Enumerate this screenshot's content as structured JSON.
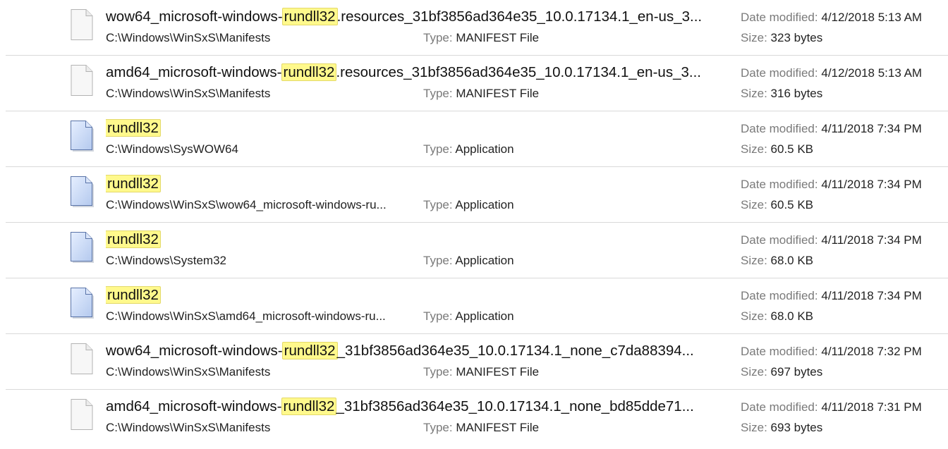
{
  "labels": {
    "type": "Type:",
    "date_modified": "Date modified:",
    "size": "Size:"
  },
  "items": [
    {
      "name_pre": "wow64_microsoft-windows-",
      "name_hl": "rundll32",
      "name_post": ".resources_31bf3856ad364e35_10.0.17134.1_en-us_3...",
      "path": "C:\\Windows\\WinSxS\\Manifests",
      "type": "MANIFEST File",
      "date_modified": "4/12/2018 5:13 AM",
      "size": "323 bytes",
      "icon": "manifest-file-icon"
    },
    {
      "name_pre": "amd64_microsoft-windows-",
      "name_hl": "rundll32",
      "name_post": ".resources_31bf3856ad364e35_10.0.17134.1_en-us_3...",
      "path": "C:\\Windows\\WinSxS\\Manifests",
      "type": "MANIFEST File",
      "date_modified": "4/12/2018 5:13 AM",
      "size": "316 bytes",
      "icon": "manifest-file-icon"
    },
    {
      "name_pre": "",
      "name_hl": "rundll32",
      "name_post": "",
      "path": "C:\\Windows\\SysWOW64",
      "type": "Application",
      "date_modified": "4/11/2018 7:34 PM",
      "size": "60.5 KB",
      "icon": "application-icon"
    },
    {
      "name_pre": "",
      "name_hl": "rundll32",
      "name_post": "",
      "path": "C:\\Windows\\WinSxS\\wow64_microsoft-windows-ru...",
      "type": "Application",
      "date_modified": "4/11/2018 7:34 PM",
      "size": "60.5 KB",
      "icon": "application-icon"
    },
    {
      "name_pre": "",
      "name_hl": "rundll32",
      "name_post": "",
      "path": "C:\\Windows\\System32",
      "type": "Application",
      "date_modified": "4/11/2018 7:34 PM",
      "size": "68.0 KB",
      "icon": "application-icon"
    },
    {
      "name_pre": "",
      "name_hl": "rundll32",
      "name_post": "",
      "path": "C:\\Windows\\WinSxS\\amd64_microsoft-windows-ru...",
      "type": "Application",
      "date_modified": "4/11/2018 7:34 PM",
      "size": "68.0 KB",
      "icon": "application-icon"
    },
    {
      "name_pre": "wow64_microsoft-windows-",
      "name_hl": "rundll32",
      "name_post": "_31bf3856ad364e35_10.0.17134.1_none_c7da88394...",
      "path": "C:\\Windows\\WinSxS\\Manifests",
      "type": "MANIFEST File",
      "date_modified": "4/11/2018 7:32 PM",
      "size": "697 bytes",
      "icon": "manifest-file-icon"
    },
    {
      "name_pre": "amd64_microsoft-windows-",
      "name_hl": "rundll32",
      "name_post": "_31bf3856ad364e35_10.0.17134.1_none_bd85dde71...",
      "path": "C:\\Windows\\WinSxS\\Manifests",
      "type": "MANIFEST File",
      "date_modified": "4/11/2018 7:31 PM",
      "size": "693 bytes",
      "icon": "manifest-file-icon"
    }
  ],
  "colors": {
    "highlight_bg": "#fff98c",
    "highlight_border": "#e3d96b",
    "label_gray": "#7a7a7a",
    "divider": "#d9d9d9",
    "app_icon_blue": "#b9cff0"
  }
}
